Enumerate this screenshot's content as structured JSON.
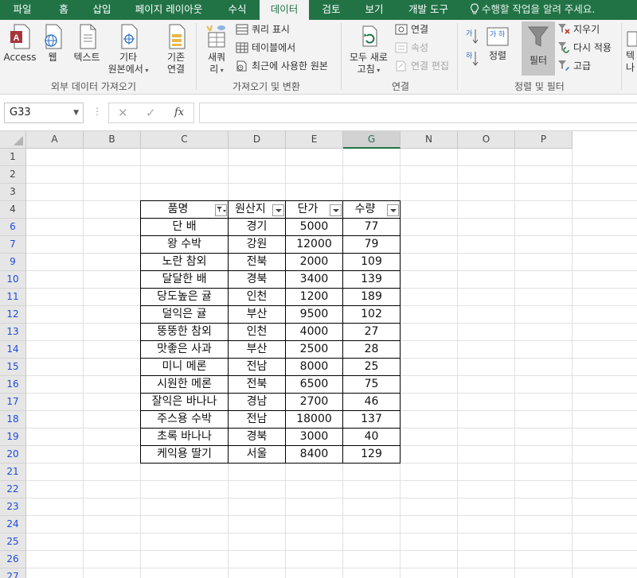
{
  "tabs": [
    "파일",
    "홈",
    "삽입",
    "페이지 레이아웃",
    "수식",
    "데이터",
    "검토",
    "보기",
    "개발 도구"
  ],
  "active_tab": "데이터",
  "tell_me": "수행할 작업을 알려 주세요.",
  "ribbon": {
    "access": "Access",
    "web": "웹",
    "text": "텍스트",
    "other_line1": "기타",
    "other_line2": "원본에서",
    "existing_line1": "기존",
    "existing_line2": "연결",
    "newquery_line1": "새쿼",
    "newquery_line2": "리",
    "show_query": "쿼리 표시",
    "from_table": "테이블에서",
    "recent_sources": "최근에 사용한 원본",
    "refresh_line1": "모두 새로",
    "refresh_line2": "고침",
    "connections": "연결",
    "properties": "속성",
    "edit_links": "연결 편집",
    "sort": "정렬",
    "filter": "필터",
    "clear": "지우기",
    "reapply": "다시 적용",
    "advanced": "고급",
    "text_to_columns_line1": "텍",
    "text_to_columns_line2": "나",
    "group_external": "외부 데이터 가져오기",
    "group_transform": "가져오기 및 변환",
    "group_connections": "연결",
    "group_sortfilter": "정렬 및 필터"
  },
  "namebox": "G33",
  "formula": "",
  "columns": [
    "A",
    "B",
    "C",
    "D",
    "E",
    "G",
    "N",
    "O",
    "P"
  ],
  "selected_column": "G",
  "rows": [
    "1",
    "2",
    "3",
    "4",
    "6",
    "7",
    "9",
    "10",
    "11",
    "12",
    "13",
    "14",
    "15",
    "16",
    "17",
    "18",
    "19",
    "20",
    "21",
    "22",
    "23",
    "24",
    "25",
    "26",
    "27"
  ],
  "table": {
    "headers": [
      "품명",
      "원산지",
      "단가",
      "수량"
    ],
    "rows": [
      [
        "단 배",
        "경기",
        "5000",
        "77"
      ],
      [
        "왕 수박",
        "강원",
        "12000",
        "79"
      ],
      [
        "노란 참외",
        "전북",
        "2000",
        "109"
      ],
      [
        "달달한 배",
        "경북",
        "3400",
        "139"
      ],
      [
        "당도높은 귤",
        "인천",
        "1200",
        "189"
      ],
      [
        "덜익은 귤",
        "부산",
        "9500",
        "102"
      ],
      [
        "뚱뚱한 참외",
        "인천",
        "4000",
        "27"
      ],
      [
        "맛좋은 사과",
        "부산",
        "2500",
        "28"
      ],
      [
        "미니 메론",
        "전남",
        "8000",
        "25"
      ],
      [
        "시원한 메론",
        "전북",
        "6500",
        "75"
      ],
      [
        "잘익은 바나나",
        "경남",
        "2700",
        "46"
      ],
      [
        "주스용 수박",
        "전남",
        "18000",
        "137"
      ],
      [
        "초록 바나나",
        "경북",
        "3000",
        "40"
      ],
      [
        "케익용 딸기",
        "서울",
        "8400",
        "129"
      ]
    ]
  },
  "colors": {
    "accent": "#217346",
    "filtered_row": "#1f4bd8",
    "filter_active_bg": "#c6c6c6"
  }
}
